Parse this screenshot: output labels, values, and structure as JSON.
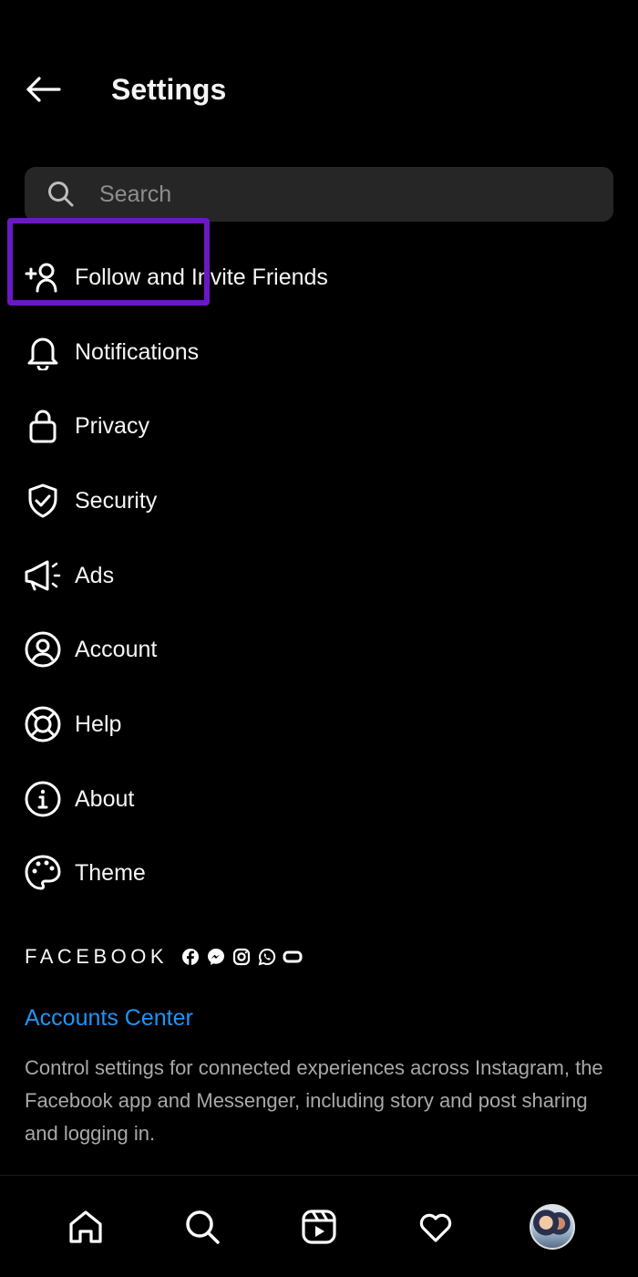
{
  "header": {
    "title": "Settings"
  },
  "search": {
    "placeholder": "Search"
  },
  "menu": {
    "items": [
      {
        "label": "Follow and Invite Friends",
        "icon": "add-person-icon"
      },
      {
        "label": "Notifications",
        "icon": "bell-icon"
      },
      {
        "label": "Privacy",
        "icon": "lock-icon"
      },
      {
        "label": "Security",
        "icon": "shield-check-icon"
      },
      {
        "label": "Ads",
        "icon": "megaphone-icon"
      },
      {
        "label": "Account",
        "icon": "user-circle-icon"
      },
      {
        "label": "Help",
        "icon": "lifebuoy-icon"
      },
      {
        "label": "About",
        "icon": "info-icon"
      },
      {
        "label": "Theme",
        "icon": "palette-icon"
      }
    ],
    "highlighted": "Security"
  },
  "facebook": {
    "brand": "FACEBOOK",
    "link": "Accounts Center",
    "description": "Control settings for connected experiences across Instagram, the Facebook app and Messenger, including story and post sharing and logging in."
  },
  "nav": {
    "items": [
      "home-icon",
      "search-icon",
      "reels-icon",
      "heart-icon",
      "profile-avatar"
    ]
  },
  "colors": {
    "background": "#000000",
    "text": "#f5f5f5",
    "link": "#1e94f5",
    "highlight": "#6a19c2",
    "search_bg": "#262626"
  }
}
